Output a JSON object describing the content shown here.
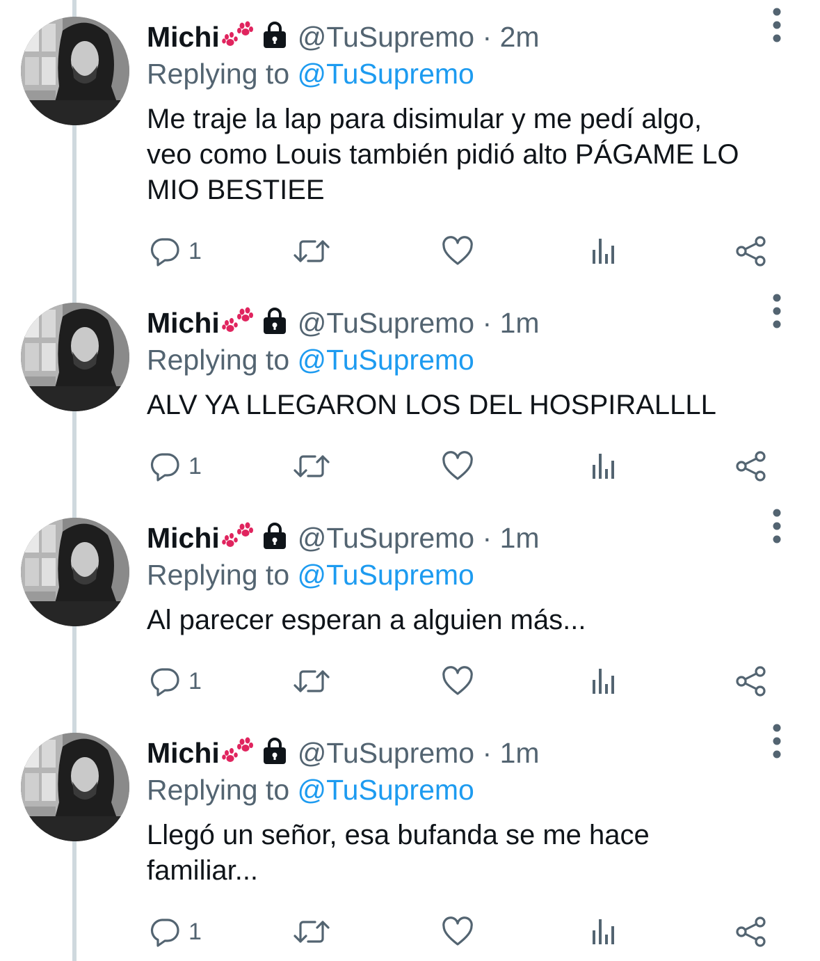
{
  "thread": {
    "tweets": [
      {
        "display_name": "Michi",
        "handle": "@TuSupremo",
        "separator": "·",
        "time": "2m",
        "replying_prefix": "Replying to",
        "replying_to": "@TuSupremo",
        "text": "Me traje la lap para disimular y me pedí algo,\nveo como Louis también pidió alto PÁGAME LO\nMIO BESTIEE",
        "reply_count": "1"
      },
      {
        "display_name": "Michi",
        "handle": "@TuSupremo",
        "separator": "·",
        "time": "1m",
        "replying_prefix": "Replying to",
        "replying_to": "@TuSupremo",
        "text": "ALV YA LLEGARON LOS DEL HOSPIRALLLL",
        "reply_count": "1"
      },
      {
        "display_name": "Michi",
        "handle": "@TuSupremo",
        "separator": "·",
        "time": "1m",
        "replying_prefix": "Replying to",
        "replying_to": "@TuSupremo",
        "text": "Al parecer esperan a alguien más...",
        "reply_count": "1"
      },
      {
        "display_name": "Michi",
        "handle": "@TuSupremo",
        "separator": "·",
        "time": "1m",
        "replying_prefix": "Replying to",
        "replying_to": "@TuSupremo",
        "text": "Llegó un señor, esa bufanda se me hace\nfamiliar...",
        "reply_count": "1"
      }
    ]
  },
  "icons": {
    "name_emoji": "paw-prints-icon",
    "protected": "lock-icon",
    "more": "more-vertical-icon",
    "reply": "reply-icon",
    "retweet": "retweet-icon",
    "like": "heart-icon",
    "analytics": "analytics-icon",
    "share": "share-icon"
  },
  "colors": {
    "text_primary": "#0f1419",
    "text_secondary": "#536471",
    "mention": "#1d9bf0",
    "thread_line": "#cfd9de",
    "paw": "#e0245e"
  }
}
